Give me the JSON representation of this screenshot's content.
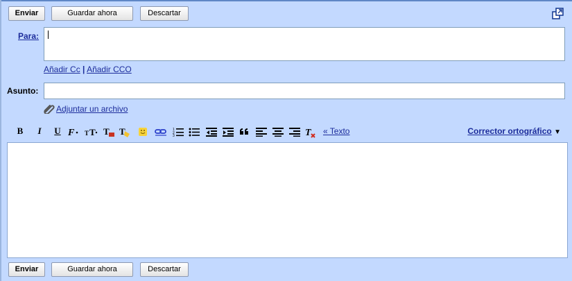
{
  "toolbar_top": {
    "send": "Enviar",
    "save": "Guardar ahora",
    "discard": "Descartar"
  },
  "toolbar_bottom": {
    "send": "Enviar",
    "save": "Guardar ahora",
    "discard": "Descartar"
  },
  "to": {
    "label": "Para:",
    "value": ""
  },
  "cc_links": {
    "add_cc": "Añadir Cc",
    "separator": "|",
    "add_bcc": "Añadir CCO"
  },
  "subject": {
    "label": "Asunto:",
    "value": ""
  },
  "attach": {
    "label": "Adjuntar un archivo"
  },
  "format_toolbar": {
    "bold": "B",
    "italic": "I",
    "underline": "U",
    "plain_text_link": "« Texto",
    "spellcheck": "Corrector ortográfico",
    "spellcheck_arrow": "▼"
  },
  "icons": [
    "bold-icon",
    "italic-icon",
    "underline-icon",
    "font-icon",
    "font-size-icon",
    "text-color-icon",
    "highlight-color-icon",
    "emoticon-icon",
    "link-icon",
    "numbered-list-icon",
    "bulleted-list-icon",
    "indent-less-icon",
    "indent-more-icon",
    "quote-icon",
    "align-left-icon",
    "align-center-icon",
    "align-right-icon",
    "remove-formatting-icon",
    "popout-icon",
    "paperclip-icon"
  ],
  "colors": {
    "background": "#c3d9ff",
    "link": "#1c2c9b",
    "border": "#7f9db9",
    "accent_top": "#5f87c6"
  }
}
